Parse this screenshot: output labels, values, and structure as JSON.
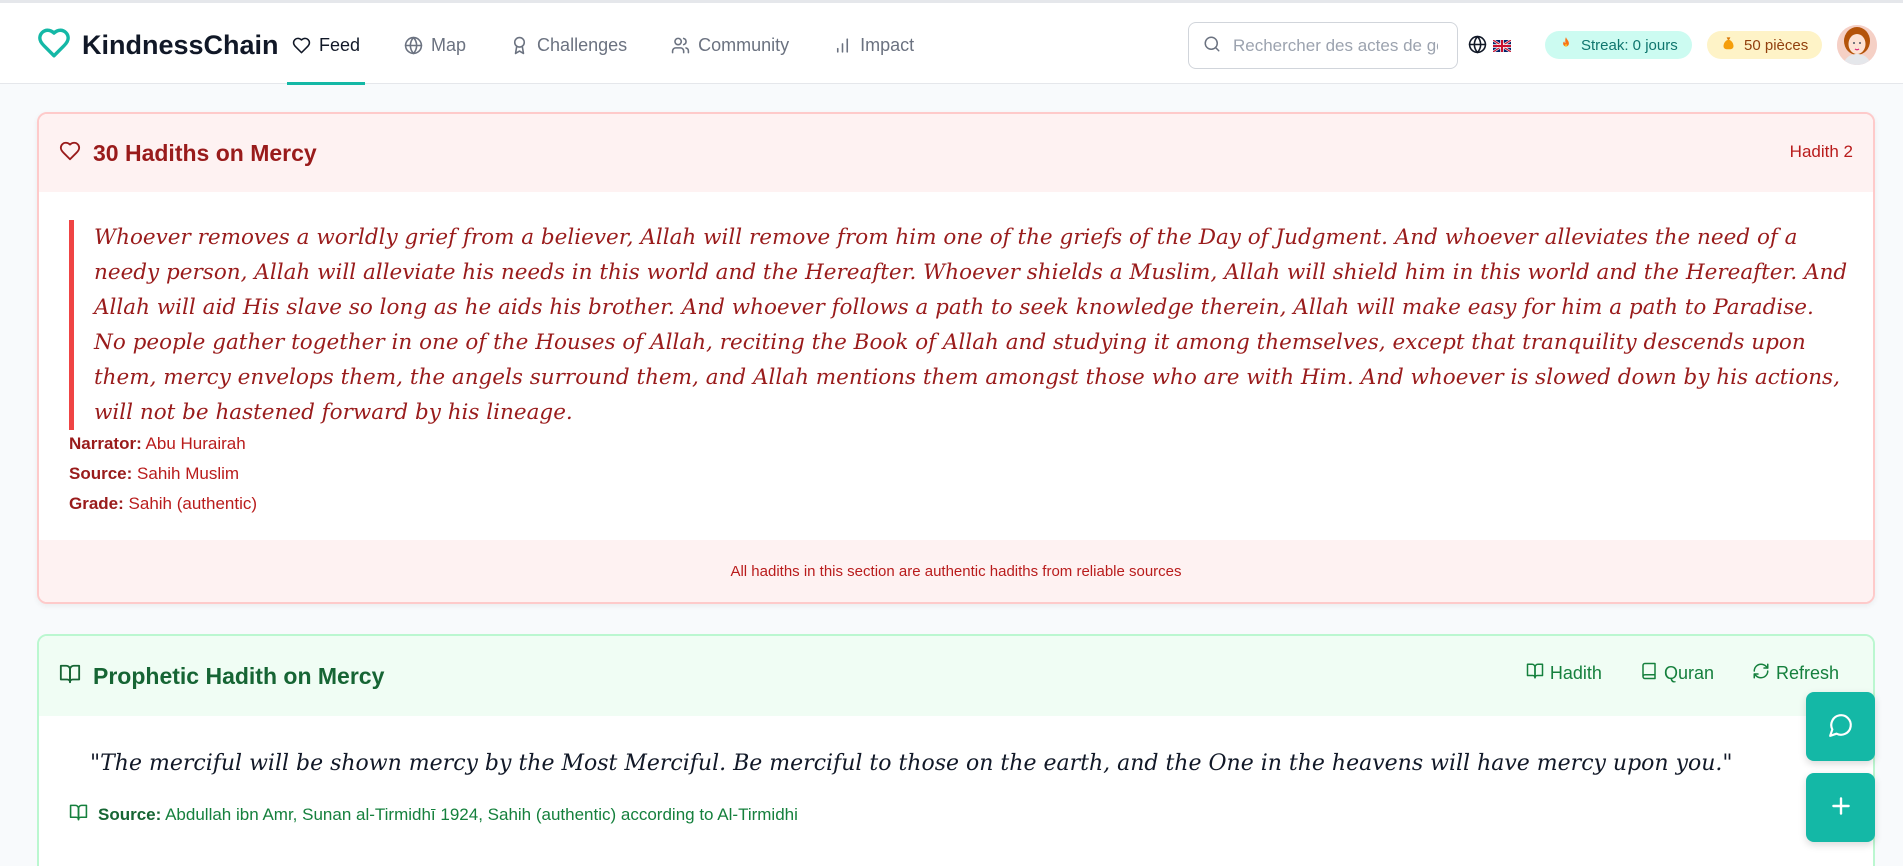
{
  "app": {
    "name": "KindnessChain"
  },
  "nav": {
    "items": [
      {
        "label": "Feed",
        "icon": "heart-icon",
        "active": true
      },
      {
        "label": "Map",
        "icon": "globe-icon"
      },
      {
        "label": "Challenges",
        "icon": "award-icon"
      },
      {
        "label": "Community",
        "icon": "users-icon"
      },
      {
        "label": "Impact",
        "icon": "bar-chart-icon"
      }
    ]
  },
  "search": {
    "placeholder": "Rechercher des actes de gentillesse...",
    "value": ""
  },
  "language": {
    "flag": "uk-flag"
  },
  "streak": {
    "label": "Streak: 0 jours",
    "icon": "flame-icon"
  },
  "coins": {
    "label": "50 pièces",
    "icon": "coin-bag-icon"
  },
  "hadith_card": {
    "title": "30 Hadiths on Mercy",
    "number_label": "Hadith 2",
    "text": "Whoever removes a worldly grief from a believer, Allah will remove from him one of the griefs of the Day of Judgment. And whoever alleviates the need of a needy person, Allah will alleviate his needs in this world and the Hereafter. Whoever shields a Muslim, Allah will shield him in this world and the Hereafter. And Allah will aid His slave so long as he aids his brother. And whoever follows a path to seek knowledge therein, Allah will make easy for him a path to Paradise. No people gather together in one of the Houses of Allah, reciting the Book of Allah and studying it among themselves, except that tranquility descends upon them, mercy envelops them, the angels surround them, and Allah mentions them amongst those who are with Him. And whoever is slowed down by his actions, will not be hastened forward by his lineage.",
    "narrator_label": "Narrator:",
    "narrator": "Abu Hurairah",
    "source_label": "Source:",
    "source": "Sahih Muslim",
    "grade_label": "Grade:",
    "grade": "Sahih (authentic)",
    "footer": "All hadiths in this section are authentic hadiths from reliable sources",
    "colors": {
      "accent": "#ef4444",
      "text": "#991b1b",
      "background": "#fef2f2"
    }
  },
  "prophetic_card": {
    "title": "Prophetic Hadith on Mercy",
    "actions": [
      {
        "label": "Hadith",
        "icon": "book-open-icon"
      },
      {
        "label": "Quran",
        "icon": "book-icon"
      },
      {
        "label": "Refresh",
        "icon": "refresh-icon"
      }
    ],
    "quote": "\"The merciful will be shown mercy by the Most Merciful. Be merciful to those on the earth, and the One in the heavens will have mercy upon you.\"",
    "source_label": "Source:",
    "source": "Abdullah ibn Amr, Sunan al-Tirmidhī 1924, Sahih (authentic) according to Al-Tirmidhi",
    "colors": {
      "accent": "#16a34a",
      "text": "#166534",
      "background": "#f0fdf4"
    }
  },
  "fabs": [
    {
      "icon": "chat-icon"
    },
    {
      "icon": "plus-icon"
    }
  ],
  "brand_color": "#14b8a6"
}
